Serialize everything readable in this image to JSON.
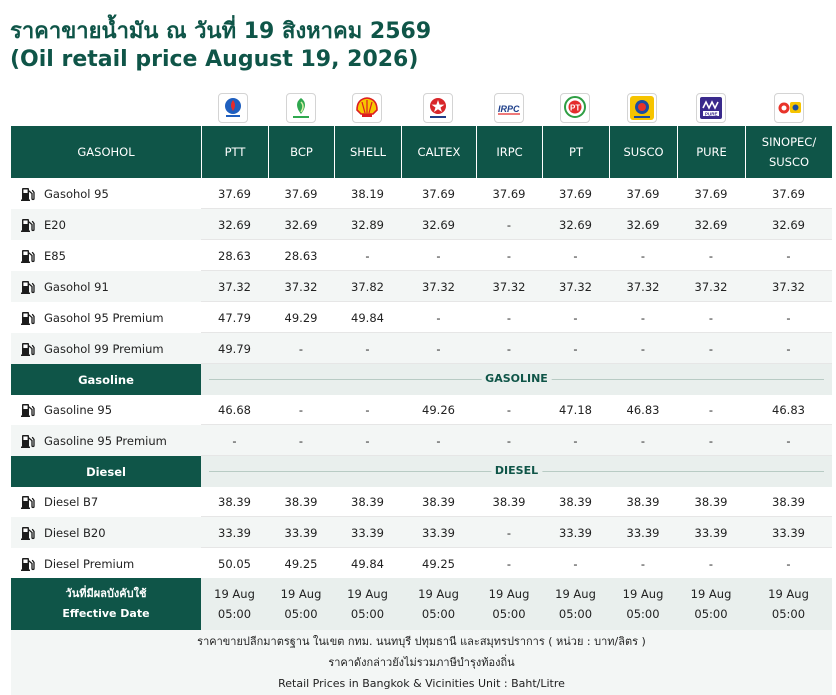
{
  "title": {
    "thai": "ราคาขายน้ำมัน ณ วันที่ 19 สิงหาคม 2569",
    "english": "(Oil retail price August 19, 2026)"
  },
  "colors": {
    "header_bg": "#0f5548",
    "band_bg": "#e9efed",
    "alt_row_bg": "#f3f6f5"
  },
  "brands": [
    {
      "name": "PTT",
      "logo": "ptt-logo"
    },
    {
      "name": "BCP",
      "logo": "bangchak-logo"
    },
    {
      "name": "SHELL",
      "logo": "shell-logo"
    },
    {
      "name": "CALTEX",
      "logo": "caltex-logo"
    },
    {
      "name": "IRPC",
      "logo": "irpc-logo"
    },
    {
      "name": "PT",
      "logo": "pt-logo"
    },
    {
      "name": "SUSCO",
      "logo": "susco-logo"
    },
    {
      "name": "PURE",
      "logo": "pure-logo"
    },
    {
      "name": "SINOPEC/\nSUSCO",
      "line1": "SINOPEC/",
      "line2": "SUSCO",
      "logo": "sinopec-susco-logo"
    }
  ],
  "header": {
    "gasohol_label": "GASOHOL"
  },
  "gasohol_rows": [
    {
      "name": "Gasohol 95",
      "prices": [
        "37.69",
        "37.69",
        "38.19",
        "37.69",
        "37.69",
        "37.69",
        "37.69",
        "37.69",
        "37.69"
      ]
    },
    {
      "name": "E20",
      "prices": [
        "32.69",
        "32.69",
        "32.89",
        "32.69",
        "-",
        "32.69",
        "32.69",
        "32.69",
        "32.69"
      ]
    },
    {
      "name": "E85",
      "prices": [
        "28.63",
        "28.63",
        "-",
        "-",
        "-",
        "-",
        "-",
        "-",
        "-"
      ]
    },
    {
      "name": "Gasohol 91",
      "prices": [
        "37.32",
        "37.32",
        "37.82",
        "37.32",
        "37.32",
        "37.32",
        "37.32",
        "37.32",
        "37.32"
      ]
    },
    {
      "name": "Gasohol 95 Premium",
      "prices": [
        "47.79",
        "49.29",
        "49.84",
        "-",
        "-",
        "-",
        "-",
        "-",
        "-"
      ]
    },
    {
      "name": "Gasohol 99 Premium",
      "prices": [
        "49.79",
        "-",
        "-",
        "-",
        "-",
        "-",
        "-",
        "-",
        "-"
      ]
    }
  ],
  "gasoline_section": {
    "label": "Gasoline",
    "band": "GASOLINE"
  },
  "gasoline_rows": [
    {
      "name": "Gasoline 95",
      "prices": [
        "46.68",
        "-",
        "-",
        "49.26",
        "-",
        "47.18",
        "46.83",
        "-",
        "46.83"
      ]
    },
    {
      "name": "Gasoline 95 Premium",
      "prices": [
        "-",
        "-",
        "-",
        "-",
        "-",
        "-",
        "-",
        "-",
        "-"
      ]
    }
  ],
  "diesel_section": {
    "label": "Diesel",
    "band": "DIESEL"
  },
  "diesel_rows": [
    {
      "name": "Diesel B7",
      "prices": [
        "38.39",
        "38.39",
        "38.39",
        "38.39",
        "38.39",
        "38.39",
        "38.39",
        "38.39",
        "38.39"
      ]
    },
    {
      "name": "Diesel B20",
      "prices": [
        "33.39",
        "33.39",
        "33.39",
        "33.39",
        "-",
        "33.39",
        "33.39",
        "33.39",
        "33.39"
      ]
    },
    {
      "name": "Diesel Premium",
      "prices": [
        "50.05",
        "49.25",
        "49.84",
        "49.25",
        "-",
        "-",
        "-",
        "-",
        "-"
      ]
    }
  ],
  "effective": {
    "label_thai": "วันที่มีผลบังคับใช้",
    "label_en": "Effective Date",
    "dates": [
      {
        "date": "19 Aug",
        "time": "05:00"
      },
      {
        "date": "19 Aug",
        "time": "05:00"
      },
      {
        "date": "19 Aug",
        "time": "05:00"
      },
      {
        "date": "19 Aug",
        "time": "05:00"
      },
      {
        "date": "19 Aug",
        "time": "05:00"
      },
      {
        "date": "19 Aug",
        "time": "05:00"
      },
      {
        "date": "19 Aug",
        "time": "05:00"
      },
      {
        "date": "19 Aug",
        "time": "05:00"
      },
      {
        "date": "19 Aug",
        "time": "05:00"
      }
    ]
  },
  "footer": {
    "line1": "ราคาขายปลีกมาตรฐาน ในเขต กทม. นนทบุรี ปทุมธานี และสมุทรปราการ ( หน่วย : บาท/ลิตร )",
    "line2": "ราคาดังกล่าวยังไม่รวมภาษีบำรุงท้องถิ่น",
    "line3": "Retail Prices in Bangkok & Vicinities Unit : Baht/Litre"
  }
}
